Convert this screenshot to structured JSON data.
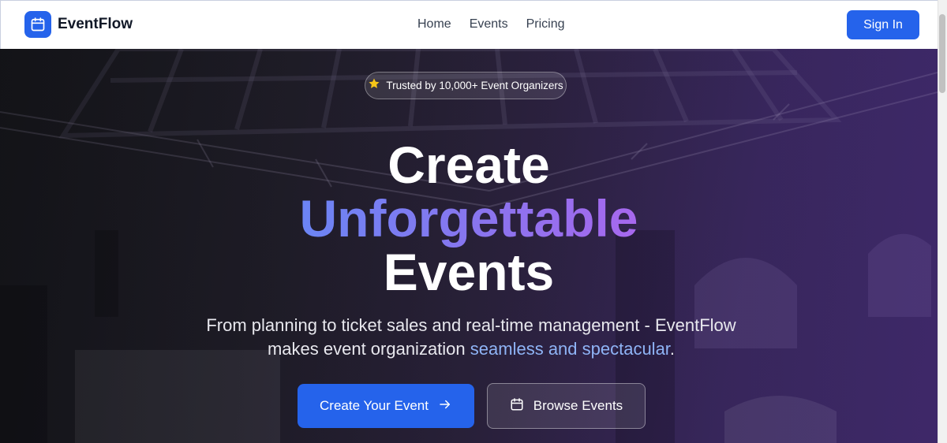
{
  "nav": {
    "brand": "EventFlow",
    "links": [
      "Home",
      "Events",
      "Pricing"
    ],
    "signin_label": "Sign In"
  },
  "hero": {
    "badge": "Trusted by 10,000+ Event Organizers",
    "headline_line1": "Create",
    "headline_line2": "Unforgettable",
    "headline_line3": "Events",
    "subtitle_line1": "From planning to ticket sales and real-time management - EventFlow",
    "subtitle_line2_prefix": "makes event organization ",
    "subtitle_highlight": "seamless and spectacular",
    "subtitle_suffix": ".",
    "primary_cta": "Create Your Event",
    "secondary_cta": "Browse Events"
  },
  "icons": {
    "brand": "calendar-icon",
    "badge": "star-icon",
    "primary_cta": "arrow-right-icon",
    "secondary_cta": "calendar-icon"
  },
  "colors": {
    "accent": "#2563eb",
    "badge_star": "#f5c518",
    "highlight_text": "#8fb4f6",
    "gradient_start": "#6b85f4",
    "gradient_end": "#a768ee"
  }
}
